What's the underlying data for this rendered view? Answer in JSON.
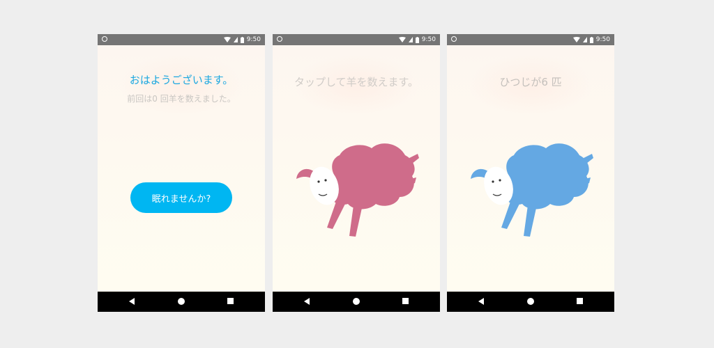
{
  "status_bar": {
    "time": "9:50"
  },
  "screens": [
    {
      "title": "おはようございます。",
      "subtitle": "前回は0 回羊を数えました。",
      "button_label": "眠れませんか?"
    },
    {
      "title": "タップして羊を数えます。",
      "sheep_color": "#cf6c8a"
    },
    {
      "title": "ひつじが6 匹",
      "sheep_color": "#64a8e3"
    }
  ],
  "colors": {
    "accent": "#00b6f2",
    "title_active": "#1aa7e0",
    "title_muted": "#d0ccc8",
    "statusbar": "#757575"
  }
}
